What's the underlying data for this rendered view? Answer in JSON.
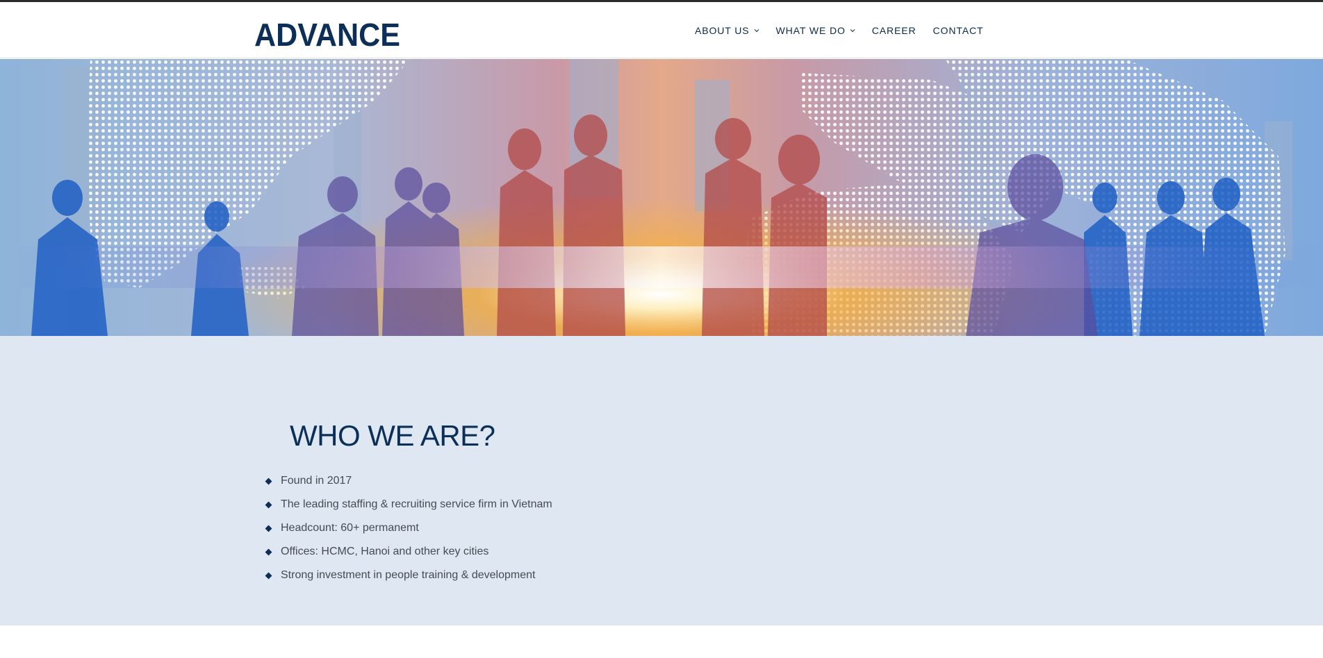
{
  "brand": {
    "logo_text": "ADVANCE",
    "color": "#0b2f57"
  },
  "nav": {
    "items": [
      {
        "label": "ABOUT US",
        "has_dropdown": true
      },
      {
        "label": "WHAT WE DO",
        "has_dropdown": true
      },
      {
        "label": "CAREER",
        "has_dropdown": false
      },
      {
        "label": "CONTACT",
        "has_dropdown": false
      }
    ]
  },
  "hero": {
    "image": "business-people-silhouettes-world-map-banner"
  },
  "who": {
    "title": "WHO WE ARE?",
    "points": [
      "Found in 2017",
      "The leading staffing & recruiting service firm in Vietnam",
      "Headcount: 60+ permanemt",
      "Offices: HCMC, Hanoi and other key cities",
      "Strong investment in people training & development"
    ]
  },
  "colors": {
    "nav_text": "#0b2a4a",
    "section_bg": "#dfe8f2",
    "heading": "#0b2f57",
    "body_text": "#444b52"
  }
}
